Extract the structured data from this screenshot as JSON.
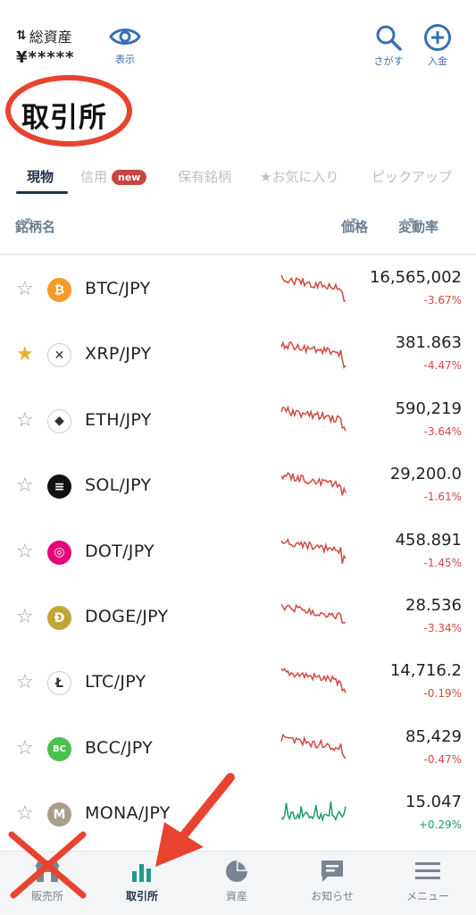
{
  "header": {
    "assets_label": "総資産",
    "assets_value": "¥*****",
    "show_label": "表示",
    "search_label": "さがす",
    "deposit_label": "入金"
  },
  "page_title": "取引所",
  "tabs": [
    {
      "label": "現物",
      "active": true
    },
    {
      "label": "信用",
      "badge": "new"
    },
    {
      "label": "保有銘柄"
    },
    {
      "label": "★お気に入り"
    },
    {
      "label": "ピックアップ"
    }
  ],
  "columns": {
    "name": "銘柄名",
    "price": "価格",
    "change": "変動率"
  },
  "rows": [
    {
      "pair": "BTC/JPY",
      "icon": "bitcoin-icon",
      "color": "#f39a2b",
      "glyph": "₿",
      "price": "16,565,002",
      "change": "-3.67%",
      "favorite": false,
      "trend": "down"
    },
    {
      "pair": "XRP/JPY",
      "icon": "xrp-icon",
      "color": "#ffffff",
      "glyph": "✕",
      "price": "381.863",
      "change": "-4.47%",
      "favorite": true,
      "trend": "down"
    },
    {
      "pair": "ETH/JPY",
      "icon": "ethereum-icon",
      "color": "#ffffff",
      "glyph": "◆",
      "price": "590,219",
      "change": "-3.64%",
      "favorite": false,
      "trend": "down"
    },
    {
      "pair": "SOL/JPY",
      "icon": "solana-icon",
      "color": "#111111",
      "glyph": "≡",
      "price": "29,200.0",
      "change": "-1.61%",
      "favorite": false,
      "trend": "down"
    },
    {
      "pair": "DOT/JPY",
      "icon": "polkadot-icon",
      "color": "#e6007a",
      "glyph": "◎",
      "price": "458.891",
      "change": "-1.45%",
      "favorite": false,
      "trend": "down"
    },
    {
      "pair": "DOGE/JPY",
      "icon": "dogecoin-icon",
      "color": "#c2a633",
      "glyph": "Đ",
      "price": "28.536",
      "change": "-3.34%",
      "favorite": false,
      "trend": "down"
    },
    {
      "pair": "LTC/JPY",
      "icon": "litecoin-icon",
      "color": "#ffffff",
      "glyph": "Ł",
      "price": "14,716.2",
      "change": "-0.19%",
      "favorite": false,
      "trend": "down"
    },
    {
      "pair": "BCC/JPY",
      "icon": "bitcoin-cash-icon",
      "color": "#4cc04f",
      "glyph": "BC",
      "price": "85,429",
      "change": "-0.47%",
      "favorite": false,
      "trend": "down"
    },
    {
      "pair": "MONA/JPY",
      "icon": "monacoin-icon",
      "color": "#a89f8a",
      "glyph": "M",
      "price": "15.047",
      "change": "+0.29%",
      "favorite": false,
      "trend": "up"
    }
  ],
  "bottom_nav": [
    {
      "label": "販売所",
      "icon": "shop-icon"
    },
    {
      "label": "取引所",
      "icon": "bar-chart-icon",
      "active": true
    },
    {
      "label": "資産",
      "icon": "pie-chart-icon"
    },
    {
      "label": "お知らせ",
      "icon": "message-icon"
    },
    {
      "label": "メニュー",
      "icon": "menu-icon"
    }
  ],
  "colors": {
    "accent": "#23324a",
    "negative": "#d04a3f",
    "positive": "#1f9a6c",
    "annotation": "#e8432f"
  }
}
